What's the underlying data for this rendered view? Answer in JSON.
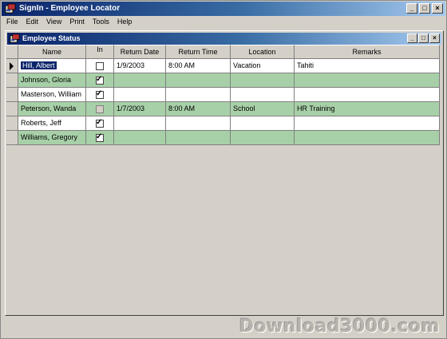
{
  "app": {
    "title": "SignIn - Employee Locator",
    "controls": {
      "minimize": "_",
      "maximize": "□",
      "close": "×"
    }
  },
  "menu": [
    "File",
    "Edit",
    "View",
    "Print",
    "Tools",
    "Help"
  ],
  "child_window": {
    "title": "Employee Status",
    "controls": {
      "minimize": "_",
      "maximize": "□",
      "close": "×"
    }
  },
  "grid": {
    "columns": [
      "Name",
      "In",
      "Return Date",
      "Return Time",
      "Location",
      "Remarks"
    ],
    "rows": [
      {
        "name": "Hill, Albert",
        "in": false,
        "in_disabled": false,
        "return_date": "1/9/2003",
        "return_time": "8:00 AM",
        "location": "Vacation",
        "remarks": "Tahiti",
        "style": "white",
        "current": true
      },
      {
        "name": "Johnson, Gloria",
        "in": true,
        "in_disabled": false,
        "return_date": "",
        "return_time": "",
        "location": "",
        "remarks": "",
        "style": "green",
        "current": false
      },
      {
        "name": "Masterson, William",
        "in": true,
        "in_disabled": false,
        "return_date": "",
        "return_time": "",
        "location": "",
        "remarks": "",
        "style": "white",
        "current": false
      },
      {
        "name": "Peterson, Wanda",
        "in": false,
        "in_disabled": true,
        "return_date": "1/7/2003",
        "return_time": "8:00 AM",
        "location": "School",
        "remarks": "HR Training",
        "style": "green",
        "current": false
      },
      {
        "name": "Roberts, Jeff",
        "in": true,
        "in_disabled": false,
        "return_date": "",
        "return_time": "",
        "location": "",
        "remarks": "",
        "style": "white",
        "current": false
      },
      {
        "name": "Williams, Gregory",
        "in": true,
        "in_disabled": false,
        "return_date": "",
        "return_time": "",
        "location": "",
        "remarks": "",
        "style": "green",
        "current": false
      }
    ]
  },
  "watermark": "Download3000.com",
  "colors": {
    "title_gradient_start": "#0a246a",
    "title_gradient_end": "#a6caf0",
    "row_green": "#a8d0a8",
    "window_bg": "#d4d0c8"
  }
}
